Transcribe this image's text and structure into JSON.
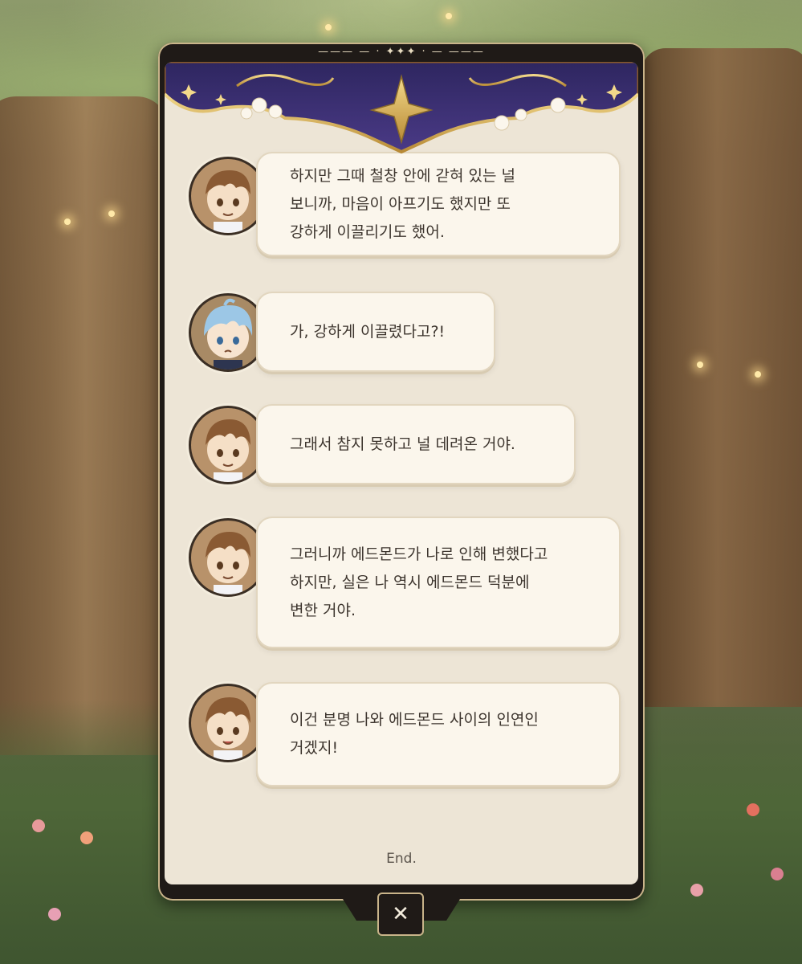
{
  "panel": {
    "top_ornament": "——— — · ✦✦✦ · — ———",
    "end_label": "End.",
    "close_symbol": "✕"
  },
  "messages": [
    {
      "speaker": "brown",
      "text": "하지만 그때 철창 안에 갇혀 있는 널\n보니까, 마음이 아프기도 했지만 또\n강하게 이끌리기도 했어."
    },
    {
      "speaker": "blue",
      "text": "가, 강하게 이끌렸다고?!"
    },
    {
      "speaker": "brown",
      "text": "그래서 참지 못하고 널 데려온 거야."
    },
    {
      "speaker": "brown",
      "text": "그러니까 에드몬드가 나로 인해 변했다고\n하지만, 실은 나 역시 에드몬드 덕분에\n변한 거야."
    },
    {
      "speaker": "brown",
      "text": "이건 분명 나와 에드몬드 사이의 인연인\n거겠지!"
    }
  ],
  "icons": {
    "close": "close-icon",
    "star": "star-ornament-icon"
  },
  "colors": {
    "panel_frame": "#1f1a17",
    "panel_bg": "#ede5d6",
    "bubble_bg": "#fbf6ec",
    "banner_purple": "#3b2d6e",
    "banner_gold": "#d9b25a"
  }
}
